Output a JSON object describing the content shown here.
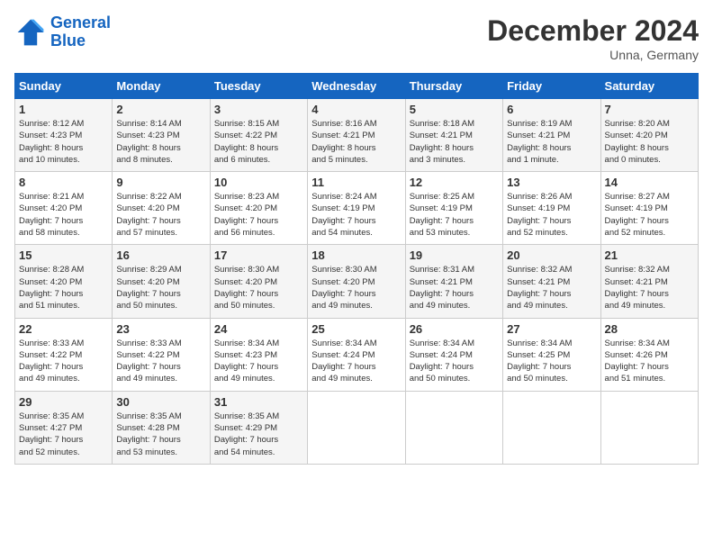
{
  "logo": {
    "line1": "General",
    "line2": "Blue"
  },
  "title": "December 2024",
  "location": "Unna, Germany",
  "days_of_week": [
    "Sunday",
    "Monday",
    "Tuesday",
    "Wednesday",
    "Thursday",
    "Friday",
    "Saturday"
  ],
  "weeks": [
    [
      {
        "day": "1",
        "text": "Sunrise: 8:12 AM\nSunset: 4:23 PM\nDaylight: 8 hours\nand 10 minutes."
      },
      {
        "day": "2",
        "text": "Sunrise: 8:14 AM\nSunset: 4:23 PM\nDaylight: 8 hours\nand 8 minutes."
      },
      {
        "day": "3",
        "text": "Sunrise: 8:15 AM\nSunset: 4:22 PM\nDaylight: 8 hours\nand 6 minutes."
      },
      {
        "day": "4",
        "text": "Sunrise: 8:16 AM\nSunset: 4:21 PM\nDaylight: 8 hours\nand 5 minutes."
      },
      {
        "day": "5",
        "text": "Sunrise: 8:18 AM\nSunset: 4:21 PM\nDaylight: 8 hours\nand 3 minutes."
      },
      {
        "day": "6",
        "text": "Sunrise: 8:19 AM\nSunset: 4:21 PM\nDaylight: 8 hours\nand 1 minute."
      },
      {
        "day": "7",
        "text": "Sunrise: 8:20 AM\nSunset: 4:20 PM\nDaylight: 8 hours\nand 0 minutes."
      }
    ],
    [
      {
        "day": "8",
        "text": "Sunrise: 8:21 AM\nSunset: 4:20 PM\nDaylight: 7 hours\nand 58 minutes."
      },
      {
        "day": "9",
        "text": "Sunrise: 8:22 AM\nSunset: 4:20 PM\nDaylight: 7 hours\nand 57 minutes."
      },
      {
        "day": "10",
        "text": "Sunrise: 8:23 AM\nSunset: 4:20 PM\nDaylight: 7 hours\nand 56 minutes."
      },
      {
        "day": "11",
        "text": "Sunrise: 8:24 AM\nSunset: 4:19 PM\nDaylight: 7 hours\nand 54 minutes."
      },
      {
        "day": "12",
        "text": "Sunrise: 8:25 AM\nSunset: 4:19 PM\nDaylight: 7 hours\nand 53 minutes."
      },
      {
        "day": "13",
        "text": "Sunrise: 8:26 AM\nSunset: 4:19 PM\nDaylight: 7 hours\nand 52 minutes."
      },
      {
        "day": "14",
        "text": "Sunrise: 8:27 AM\nSunset: 4:19 PM\nDaylight: 7 hours\nand 52 minutes."
      }
    ],
    [
      {
        "day": "15",
        "text": "Sunrise: 8:28 AM\nSunset: 4:20 PM\nDaylight: 7 hours\nand 51 minutes."
      },
      {
        "day": "16",
        "text": "Sunrise: 8:29 AM\nSunset: 4:20 PM\nDaylight: 7 hours\nand 50 minutes."
      },
      {
        "day": "17",
        "text": "Sunrise: 8:30 AM\nSunset: 4:20 PM\nDaylight: 7 hours\nand 50 minutes."
      },
      {
        "day": "18",
        "text": "Sunrise: 8:30 AM\nSunset: 4:20 PM\nDaylight: 7 hours\nand 49 minutes."
      },
      {
        "day": "19",
        "text": "Sunrise: 8:31 AM\nSunset: 4:21 PM\nDaylight: 7 hours\nand 49 minutes."
      },
      {
        "day": "20",
        "text": "Sunrise: 8:32 AM\nSunset: 4:21 PM\nDaylight: 7 hours\nand 49 minutes."
      },
      {
        "day": "21",
        "text": "Sunrise: 8:32 AM\nSunset: 4:21 PM\nDaylight: 7 hours\nand 49 minutes."
      }
    ],
    [
      {
        "day": "22",
        "text": "Sunrise: 8:33 AM\nSunset: 4:22 PM\nDaylight: 7 hours\nand 49 minutes."
      },
      {
        "day": "23",
        "text": "Sunrise: 8:33 AM\nSunset: 4:22 PM\nDaylight: 7 hours\nand 49 minutes."
      },
      {
        "day": "24",
        "text": "Sunrise: 8:34 AM\nSunset: 4:23 PM\nDaylight: 7 hours\nand 49 minutes."
      },
      {
        "day": "25",
        "text": "Sunrise: 8:34 AM\nSunset: 4:24 PM\nDaylight: 7 hours\nand 49 minutes."
      },
      {
        "day": "26",
        "text": "Sunrise: 8:34 AM\nSunset: 4:24 PM\nDaylight: 7 hours\nand 50 minutes."
      },
      {
        "day": "27",
        "text": "Sunrise: 8:34 AM\nSunset: 4:25 PM\nDaylight: 7 hours\nand 50 minutes."
      },
      {
        "day": "28",
        "text": "Sunrise: 8:34 AM\nSunset: 4:26 PM\nDaylight: 7 hours\nand 51 minutes."
      }
    ],
    [
      {
        "day": "29",
        "text": "Sunrise: 8:35 AM\nSunset: 4:27 PM\nDaylight: 7 hours\nand 52 minutes."
      },
      {
        "day": "30",
        "text": "Sunrise: 8:35 AM\nSunset: 4:28 PM\nDaylight: 7 hours\nand 53 minutes."
      },
      {
        "day": "31",
        "text": "Sunrise: 8:35 AM\nSunset: 4:29 PM\nDaylight: 7 hours\nand 54 minutes."
      },
      {
        "day": "",
        "text": ""
      },
      {
        "day": "",
        "text": ""
      },
      {
        "day": "",
        "text": ""
      },
      {
        "day": "",
        "text": ""
      }
    ]
  ]
}
